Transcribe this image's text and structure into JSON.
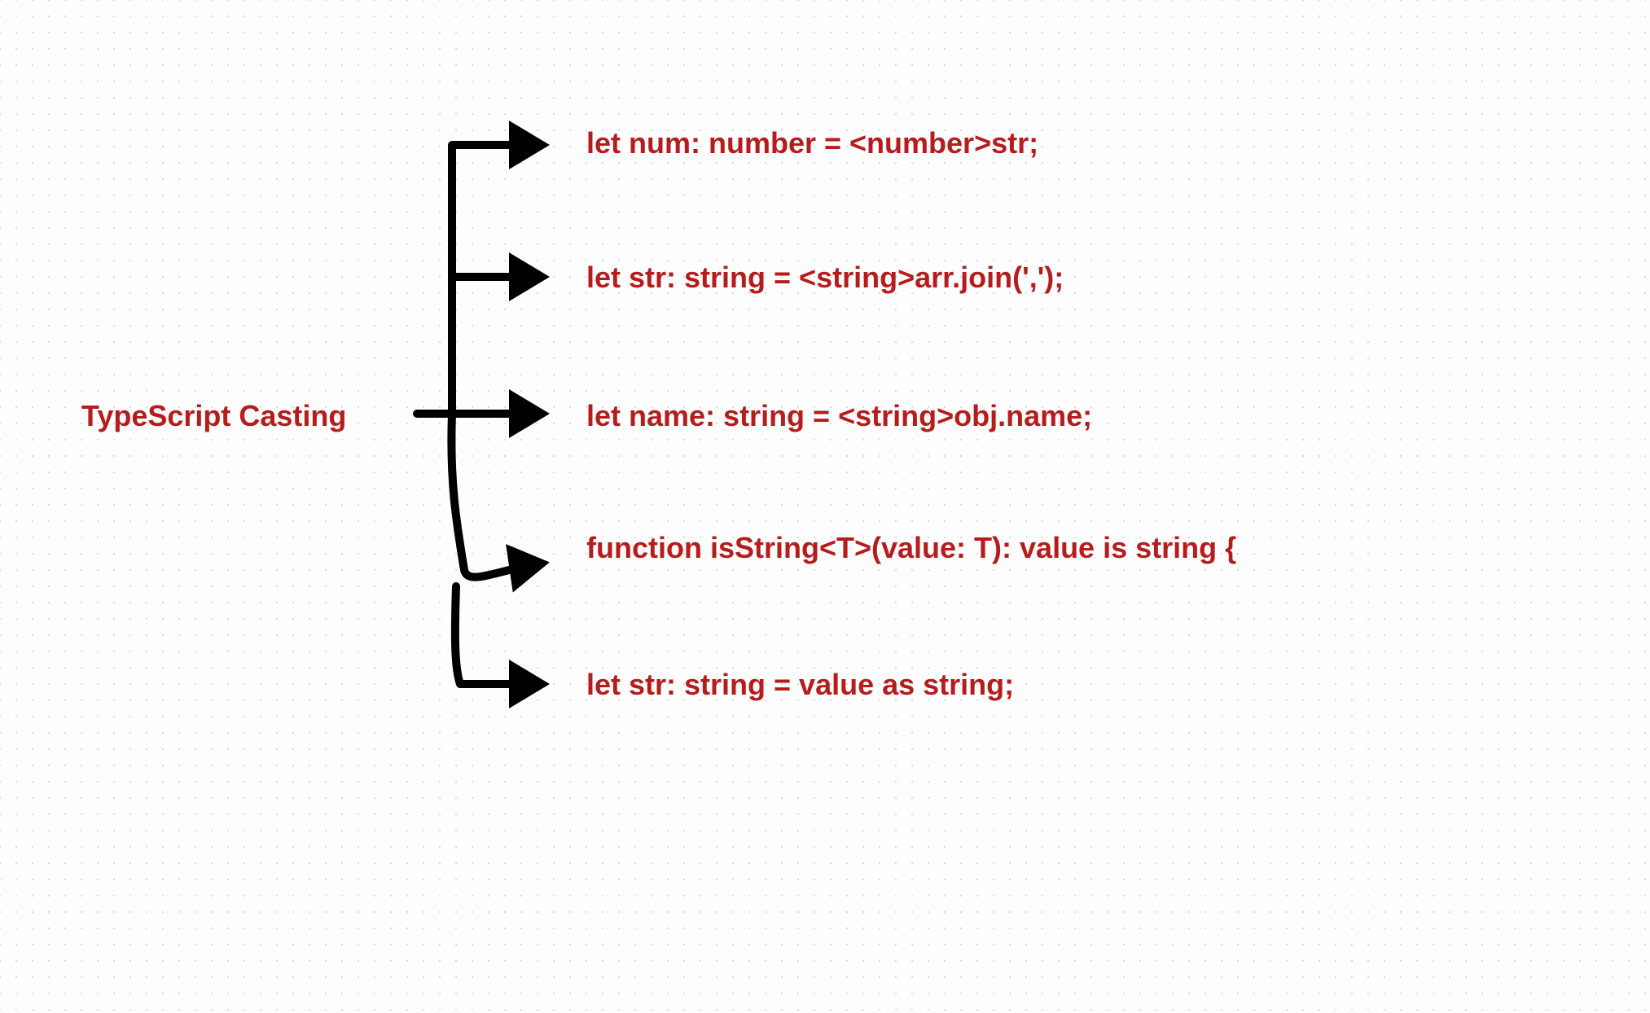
{
  "root": "TypeScript Casting",
  "branches": [
    "let num: number = <number>str;",
    "let str: string = <string>arr.join(',');",
    "let name: string = <string>obj.name;",
    "function isString<T>(value: T): value is string {",
    "let str: string = value as string;"
  ],
  "colors": {
    "text": "#b71c1c",
    "arrow": "#000000"
  }
}
